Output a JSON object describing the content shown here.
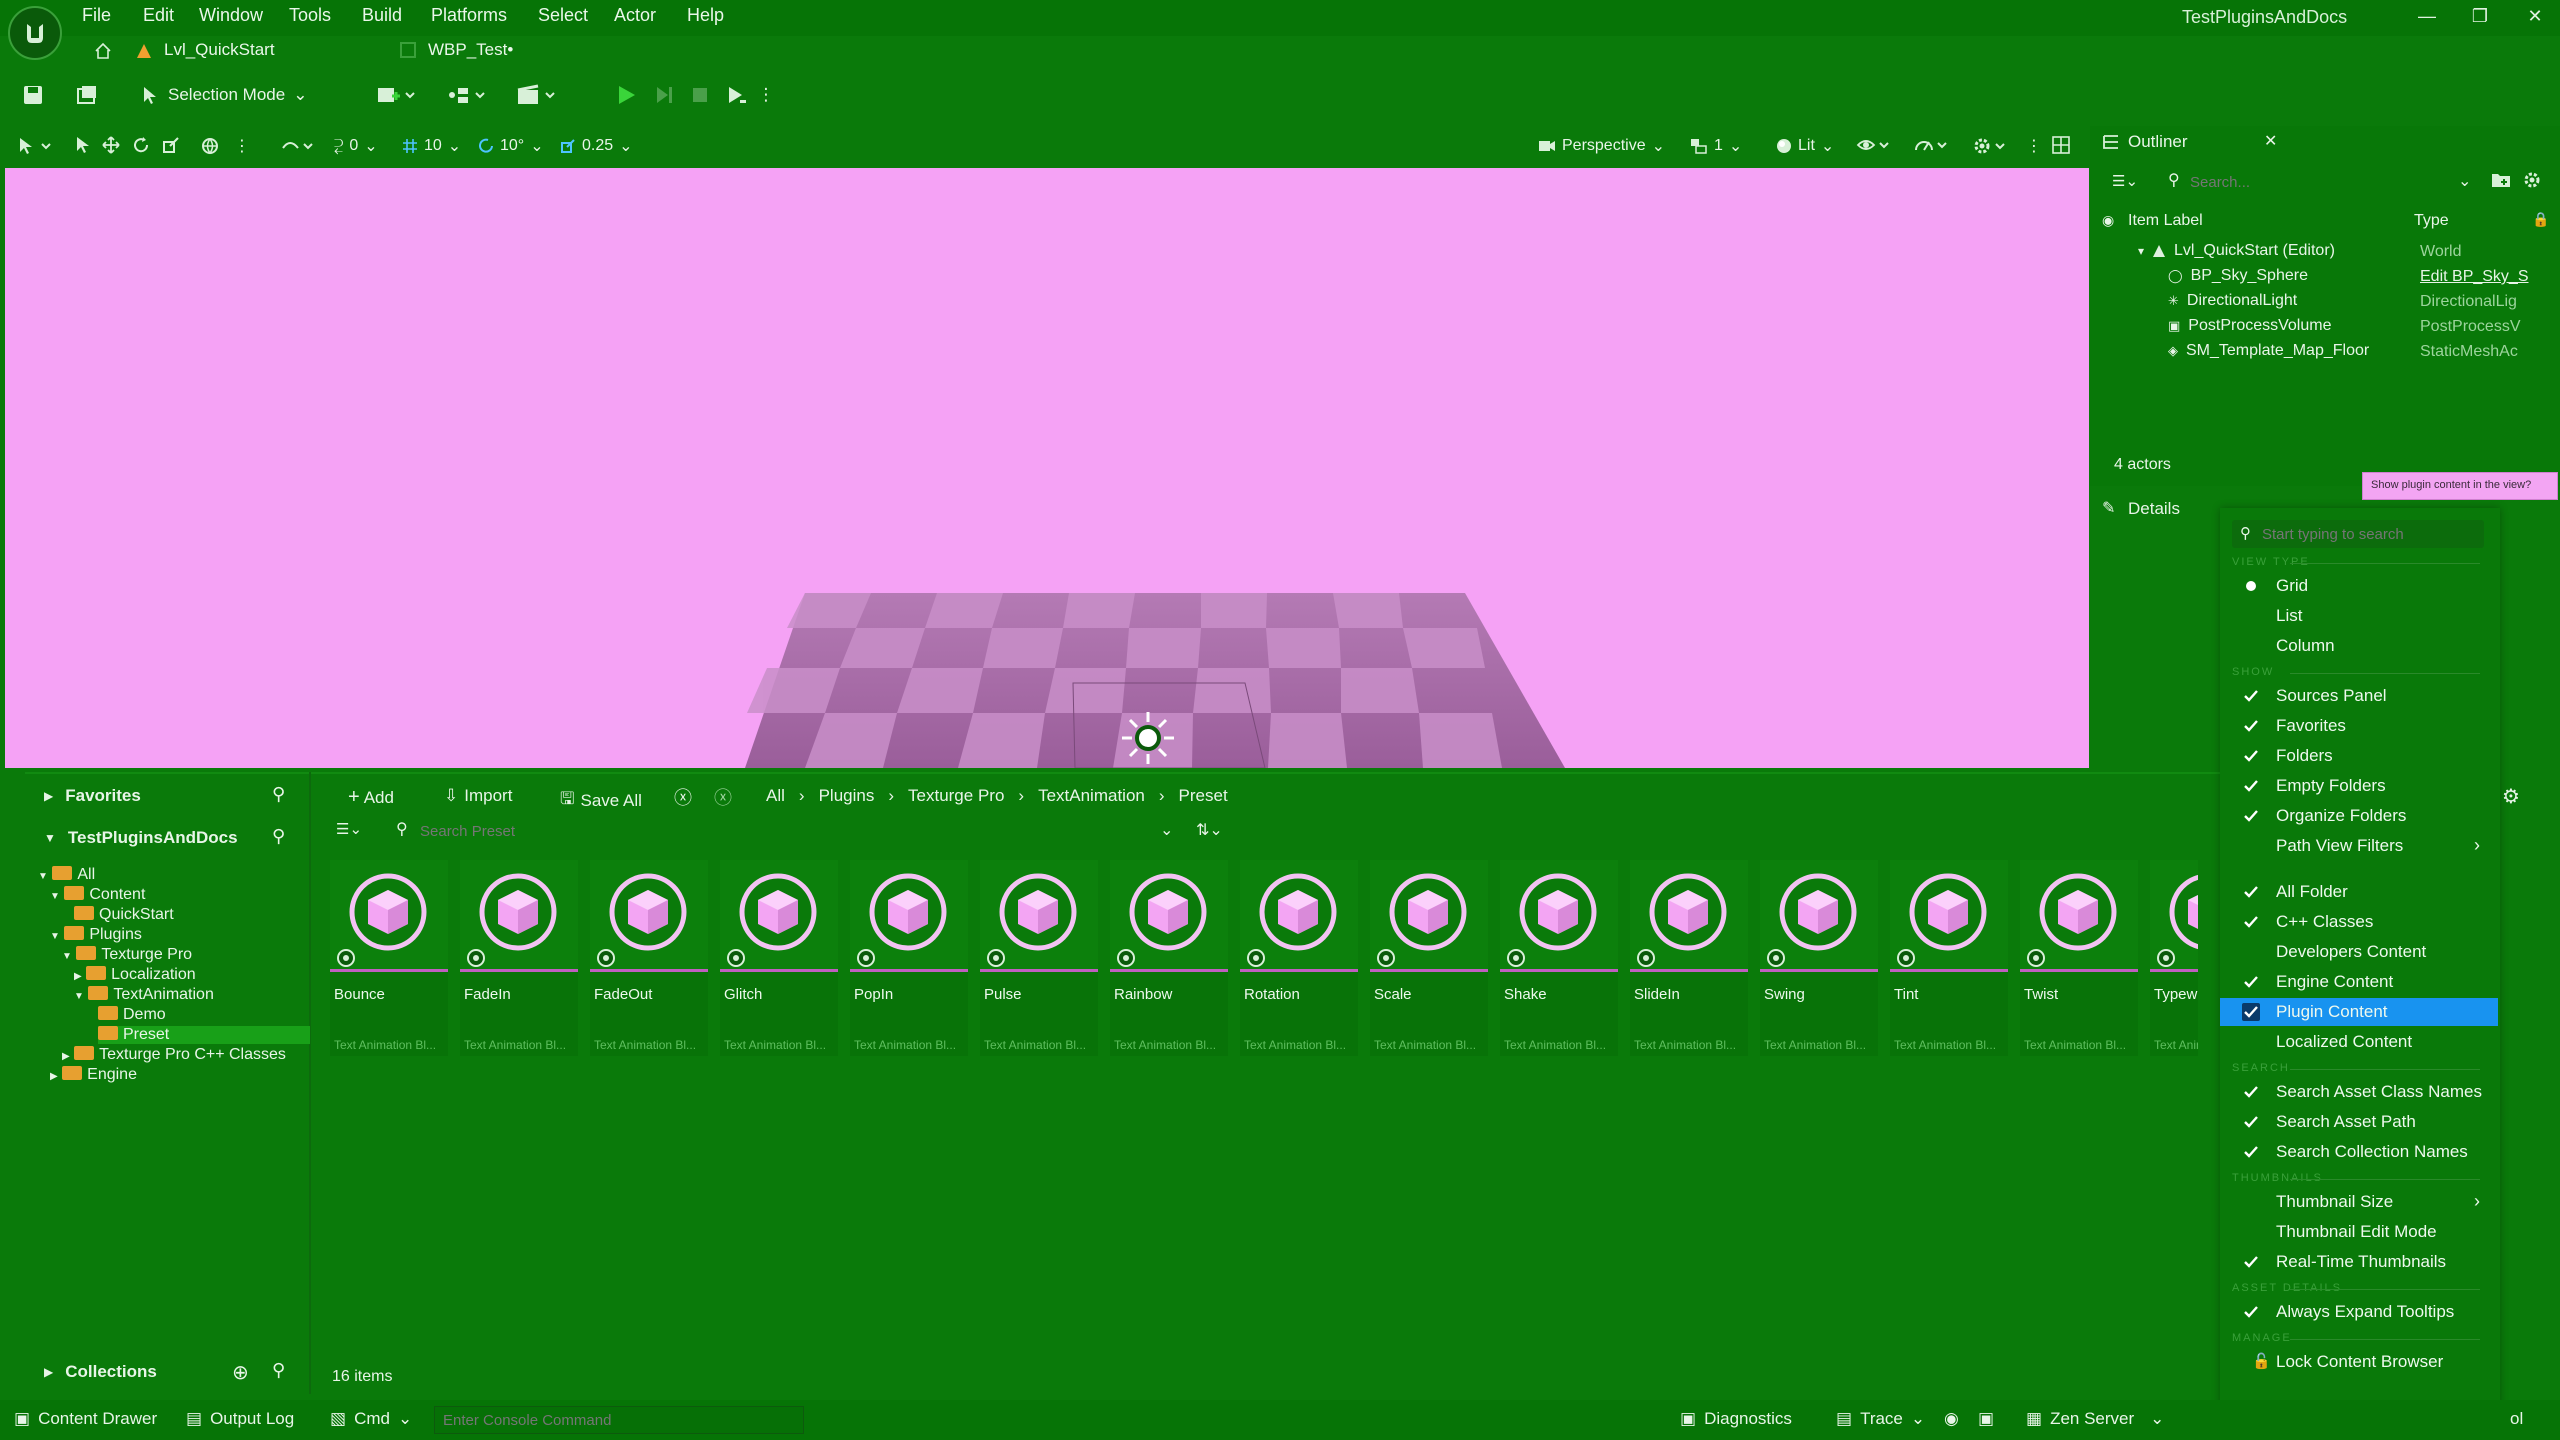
{
  "app": {
    "title": "TestPluginsAndDocs"
  },
  "menu": [
    "File",
    "Edit",
    "Window",
    "Tools",
    "Build",
    "Platforms",
    "Select",
    "Actor",
    "Help"
  ],
  "tabs": {
    "level": "Lvl_QuickStart",
    "widget": "WBP_Test•"
  },
  "toolbar": {
    "mode": "Selection Mode"
  },
  "viewport_toolbar": {
    "angle": "0",
    "grid": "10",
    "rotation": "10°",
    "scale": "0.25",
    "perspective": "Perspective",
    "cameras": "1",
    "lit": "Lit"
  },
  "outliner": {
    "title": "Outliner",
    "search_placeholder": "Search...",
    "col_label": "Item Label",
    "col_type": "Type",
    "rows": [
      {
        "label": "Lvl_QuickStart (Editor)",
        "type": "World"
      },
      {
        "label": "BP_Sky_Sphere",
        "type": "Edit BP_Sky_S"
      },
      {
        "label": "DirectionalLight",
        "type": "DirectionalLig"
      },
      {
        "label": "PostProcessVolume",
        "type": "PostProcessV"
      },
      {
        "label": "SM_Template_Map_Floor",
        "type": "StaticMeshAc"
      }
    ],
    "count": "4 actors"
  },
  "details": {
    "title": "Details"
  },
  "tooltip": "Show plugin content in the view?",
  "content_browser": {
    "favorites": "Favorites",
    "project": "TestPluginsAndDocs",
    "collections": "Collections",
    "add": "Add",
    "import": "Import",
    "save_all": "Save All",
    "search_placeholder": "Search Preset",
    "breadcrumb": [
      "All",
      "Plugins",
      "Texturge Pro",
      "TextAnimation",
      "Preset"
    ],
    "item_count": "16 items",
    "tree": [
      {
        "label": "All",
        "depth": 0
      },
      {
        "label": "Content",
        "depth": 1
      },
      {
        "label": "QuickStart",
        "depth": 2
      },
      {
        "label": "Plugins",
        "depth": 1
      },
      {
        "label": "Texturge Pro",
        "depth": 2
      },
      {
        "label": "Localization",
        "depth": 3
      },
      {
        "label": "TextAnimation",
        "depth": 3
      },
      {
        "label": "Demo",
        "depth": 4
      },
      {
        "label": "Preset",
        "depth": 4
      },
      {
        "label": "Texturge Pro C++ Classes",
        "depth": 2
      },
      {
        "label": "Engine",
        "depth": 1
      }
    ],
    "assets": [
      {
        "name": "Bounce",
        "type": "Text Animation Bl..."
      },
      {
        "name": "FadeIn",
        "type": "Text Animation Bl..."
      },
      {
        "name": "FadeOut",
        "type": "Text Animation Bl..."
      },
      {
        "name": "Glitch",
        "type": "Text Animation Bl..."
      },
      {
        "name": "PopIn",
        "type": "Text Animation Bl..."
      },
      {
        "name": "Pulse",
        "type": "Text Animation Bl..."
      },
      {
        "name": "Rainbow",
        "type": "Text Animation Bl..."
      },
      {
        "name": "Rotation",
        "type": "Text Animation Bl..."
      },
      {
        "name": "Scale",
        "type": "Text Animation Bl..."
      },
      {
        "name": "Shake",
        "type": "Text Animation Bl..."
      },
      {
        "name": "SlideIn",
        "type": "Text Animation Bl..."
      },
      {
        "name": "Swing",
        "type": "Text Animation Bl..."
      },
      {
        "name": "Tint",
        "type": "Text Animation Bl..."
      },
      {
        "name": "Twist",
        "type": "Text Animation Bl..."
      },
      {
        "name": "Typewrite",
        "type": "Text Animat"
      }
    ]
  },
  "view_options": {
    "search_placeholder": "Start typing to search",
    "sections": {
      "view_type": "VIEW TYPE",
      "show": "SHOW",
      "search": "SEARCH",
      "thumbnails": "THUMBNAILS",
      "asset_details": "ASSET DETAILS",
      "manage": "MANAGE"
    },
    "view_type": [
      {
        "label": "Grid",
        "selected": true
      },
      {
        "label": "List",
        "selected": false
      },
      {
        "label": "Column",
        "selected": false
      }
    ],
    "show": [
      {
        "label": "Sources Panel",
        "checked": true
      },
      {
        "label": "Favorites",
        "checked": true
      },
      {
        "label": "Folders",
        "checked": true
      },
      {
        "label": "Empty Folders",
        "checked": true
      },
      {
        "label": "Organize Folders",
        "checked": true
      },
      {
        "label": "Path View Filters",
        "checked": false,
        "submenu": true
      },
      {
        "label": "All Folder",
        "checked": true
      },
      {
        "label": "C++ Classes",
        "checked": true
      },
      {
        "label": "Developers Content",
        "checked": false
      },
      {
        "label": "Engine Content",
        "checked": true
      },
      {
        "label": "Plugin Content",
        "checked": true,
        "highlight": true
      },
      {
        "label": "Localized Content",
        "checked": false
      }
    ],
    "search": [
      {
        "label": "Search Asset Class Names",
        "checked": true
      },
      {
        "label": "Search Asset Path",
        "checked": true
      },
      {
        "label": "Search Collection Names",
        "checked": true
      }
    ],
    "thumbnails": [
      {
        "label": "Thumbnail Size",
        "checked": false,
        "submenu": true
      },
      {
        "label": "Thumbnail Edit Mode",
        "checked": false
      },
      {
        "label": "Real-Time Thumbnails",
        "checked": true
      }
    ],
    "asset_details": [
      {
        "label": "Always Expand Tooltips",
        "checked": true
      }
    ],
    "manage": [
      {
        "label": "Lock Content Browser",
        "checked": false
      }
    ]
  },
  "statusbar": {
    "content_drawer": "Content Drawer",
    "output_log": "Output Log",
    "cmd": "Cmd",
    "console_placeholder": "Enter Console Command",
    "diagnostics": "Diagnostics",
    "trace": "Trace",
    "zen": "Zen Server",
    "ol": "ol"
  },
  "colors": {
    "panel": "#0a7a0a",
    "viewport": "#f5a2f5",
    "highlight": "#1893f0",
    "play": "#3ad53a"
  }
}
